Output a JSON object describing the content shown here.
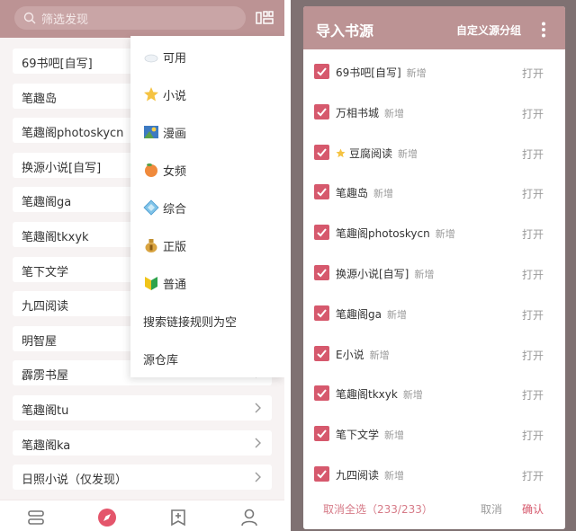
{
  "left": {
    "search": {
      "placeholder": "筛选发现"
    },
    "list": [
      "69书吧[自写]",
      "笔趣岛",
      "笔趣阁photoskycn",
      "换源小说[自写]",
      "笔趣阁ga",
      "笔趣阁tkxyk",
      "笔下文学",
      "九四阅读",
      "明智屋",
      "霹雳书屋",
      "笔趣阁tu",
      "笔趣阁ka",
      "日照小说（仅发现）"
    ],
    "menu": [
      {
        "icon": "cloud-icon",
        "label": "可用"
      },
      {
        "icon": "star-icon",
        "label": "小说"
      },
      {
        "icon": "picture-icon",
        "label": "漫画"
      },
      {
        "icon": "peach-icon",
        "label": "女频"
      },
      {
        "icon": "diamond-icon",
        "label": "综合"
      },
      {
        "icon": "money-bag-icon",
        "label": "正版"
      },
      {
        "icon": "beginner-icon",
        "label": "普通"
      },
      {
        "icon": "",
        "label": "搜索链接规则为空"
      },
      {
        "icon": "",
        "label": "源仓库"
      }
    ],
    "bottom_nav": [
      "bookshelf-icon",
      "discover-icon",
      "rss-icon",
      "profile-icon"
    ]
  },
  "right": {
    "title": "导入书源",
    "custom_group": "自定义源分组",
    "new_tag": "新增",
    "open_label": "打开",
    "items": [
      {
        "name": "69书吧[自写]",
        "star": false
      },
      {
        "name": "万相书城",
        "star": false
      },
      {
        "name": "豆腐阅读",
        "star": true
      },
      {
        "name": "笔趣岛",
        "star": false
      },
      {
        "name": "笔趣阁photoskycn",
        "star": false
      },
      {
        "name": "换源小说[自写]",
        "star": false
      },
      {
        "name": "笔趣阁ga",
        "star": false
      },
      {
        "name": "E小说",
        "star": false
      },
      {
        "name": "笔趣阁tkxyk",
        "star": false
      },
      {
        "name": "笔下文学",
        "star": false
      },
      {
        "name": "九四阅读",
        "star": false
      }
    ],
    "footer": {
      "deselect": "取消全选（233/233）",
      "cancel": "取消",
      "confirm": "确认"
    }
  },
  "colors": {
    "primary": "#bc9394",
    "accent": "#d6596d",
    "overlay": "#7f7172"
  }
}
